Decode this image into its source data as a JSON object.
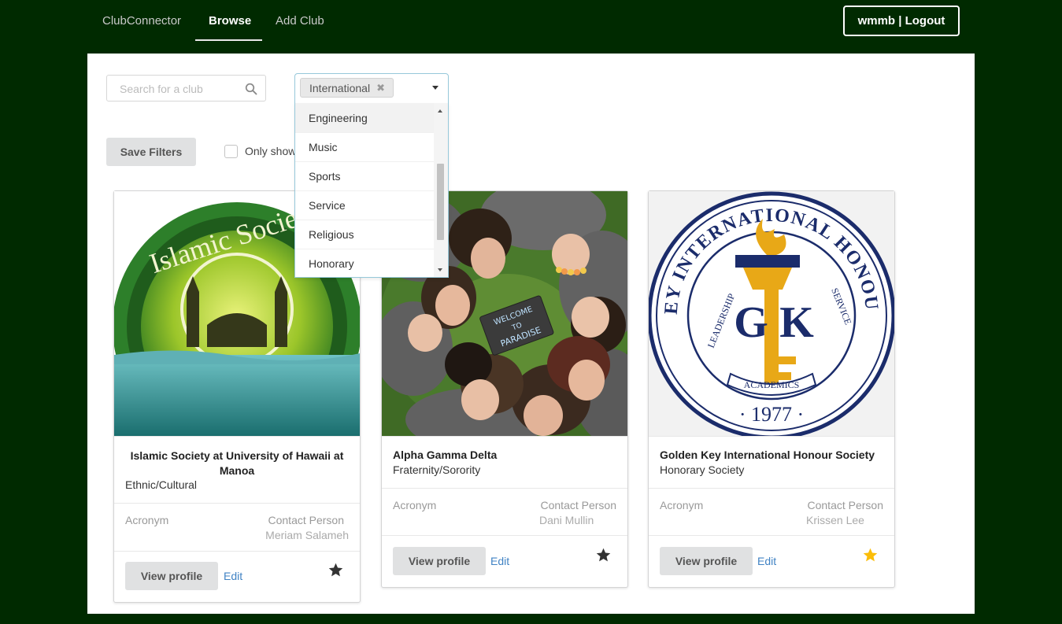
{
  "nav": {
    "brand": "ClubConnector",
    "browse": "Browse",
    "add_club": "Add Club",
    "logout": "wmmb | Logout"
  },
  "filters": {
    "search_placeholder": "Search for a club",
    "selected_chip": "International",
    "dropdown_options": [
      "Engineering",
      "Music",
      "Sports",
      "Service",
      "Religious",
      "Honorary"
    ],
    "save_label": "Save Filters",
    "checkbox_label": "Only show"
  },
  "cards": [
    {
      "title_line1": "Islamic Society at University of Hawaii at",
      "title_line2": "Manoa",
      "category": "Ethnic/Cultural",
      "acronym_label": "Acronym",
      "contact_label": "Contact Person",
      "contact_name": "Meriam Salameh",
      "view_label": "View profile",
      "edit_label": "Edit",
      "starred": false,
      "image_text": "Islamic Society"
    },
    {
      "title": "Alpha Gamma Delta",
      "category": "Fraternity/Sorority",
      "acronym_label": "Acronym",
      "contact_label": "Contact Person",
      "contact_name": "Dani Mullin",
      "view_label": "View profile",
      "edit_label": "Edit",
      "starred": false,
      "image_sign_line1": "WELCOME",
      "image_sign_line2": "TO",
      "image_sign_line3": "PARADISE"
    },
    {
      "title": "Golden Key International Honour Society",
      "category": "Honorary Society",
      "acronym_label": "Acronym",
      "contact_label": "Contact Person",
      "contact_name": "Krissen Lee",
      "view_label": "View profile",
      "edit_label": "Edit",
      "starred": true,
      "seal_ring_text": "GOLDEN KEY INTERNATIONAL HONOUR SOCIETY",
      "seal_left": "LEADERSHIP",
      "seal_right": "SERVICE",
      "seal_banner": "ACADEMICS",
      "seal_year": "· 1977 ·",
      "seal_monogram_g": "G",
      "seal_monogram_k": "K"
    }
  ],
  "colors": {
    "page_bg": "#002a00",
    "link": "#4183c4",
    "star_active": "#fbbd08",
    "star_inactive": "#333333",
    "seal_navy": "#1b2c6b",
    "seal_gold": "#e8a817"
  }
}
